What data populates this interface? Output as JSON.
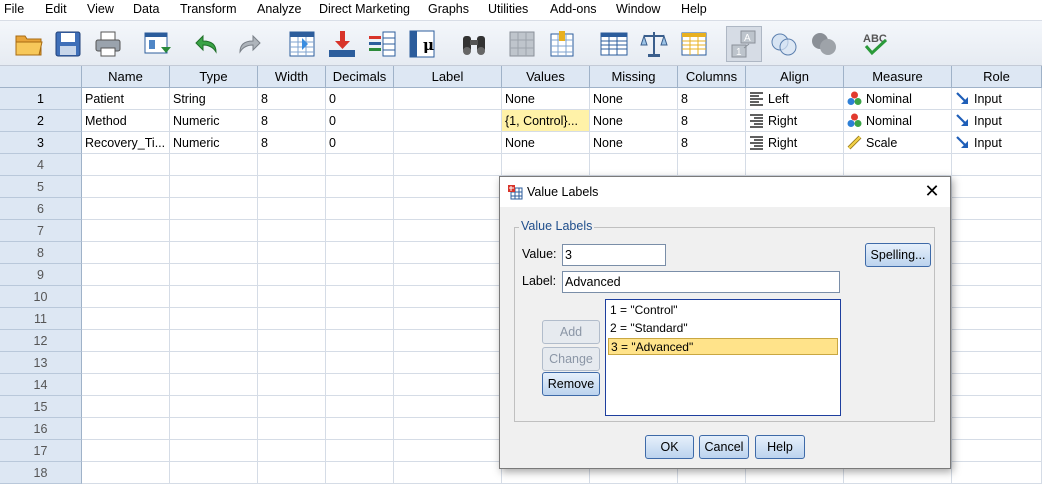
{
  "menu": [
    "File",
    "Edit",
    "View",
    "Data",
    "Transform",
    "Analyze",
    "Direct Marketing",
    "Graphs",
    "Utilities",
    "Add-ons",
    "Window",
    "Help"
  ],
  "toolbar": {
    "icons": [
      "open-icon",
      "save-icon",
      "print-icon",
      "recall-dialog-icon",
      "undo-icon",
      "redo-icon",
      "go-to-case-icon",
      "go-to-variable-icon",
      "variables-icon",
      "statistics-icon",
      "find-icon",
      "insert-cases-icon",
      "insert-variable-icon",
      "split-file-icon",
      "weight-cases-icon",
      "select-cases-icon",
      "value-labels-icon",
      "use-variable-sets-icon",
      "show-all-variables-icon",
      "spell-check-icon"
    ]
  },
  "grid": {
    "columns": [
      "Name",
      "Type",
      "Width",
      "Decimals",
      "Label",
      "Values",
      "Missing",
      "Columns",
      "Align",
      "Measure",
      "Role"
    ],
    "rows": [
      {
        "num": "1",
        "name": "Patient",
        "type": "String",
        "width": "8",
        "decimals": "0",
        "label": "",
        "values": "None",
        "missing": "None",
        "columns": "8",
        "align": "Left",
        "measure": "Nominal",
        "role": "Input"
      },
      {
        "num": "2",
        "name": "Method",
        "type": "Numeric",
        "width": "8",
        "decimals": "0",
        "label": "",
        "values": "{1, Control}...",
        "missing": "None",
        "columns": "8",
        "align": "Right",
        "measure": "Nominal",
        "role": "Input"
      },
      {
        "num": "3",
        "name": "Recovery_Ti...",
        "type": "Numeric",
        "width": "8",
        "decimals": "0",
        "label": "",
        "values": "None",
        "missing": "None",
        "columns": "8",
        "align": "Right",
        "measure": "Scale",
        "role": "Input"
      }
    ],
    "empty_row_numbers": [
      "4",
      "5",
      "6",
      "7",
      "8",
      "9",
      "10",
      "11",
      "12",
      "13",
      "14",
      "15",
      "16",
      "17",
      "18"
    ]
  },
  "dialog": {
    "title": "Value Labels",
    "group_label": "Value Labels",
    "value_label": "Value:",
    "value": "3",
    "label_label": "Label:",
    "label_value": "Advanced",
    "list_items": [
      "1 = \"Control\"",
      "2 = \"Standard\"",
      "3 = \"Advanced\""
    ],
    "selected_index": 2,
    "buttons": {
      "add": "Add",
      "change": "Change",
      "remove": "Remove",
      "spelling": "Spelling...",
      "ok": "OK",
      "cancel": "Cancel",
      "help": "Help"
    }
  },
  "colors": {
    "header_bg": "#dde7f3",
    "selection": "#fff2a8",
    "accent": "#3e6aa8"
  }
}
